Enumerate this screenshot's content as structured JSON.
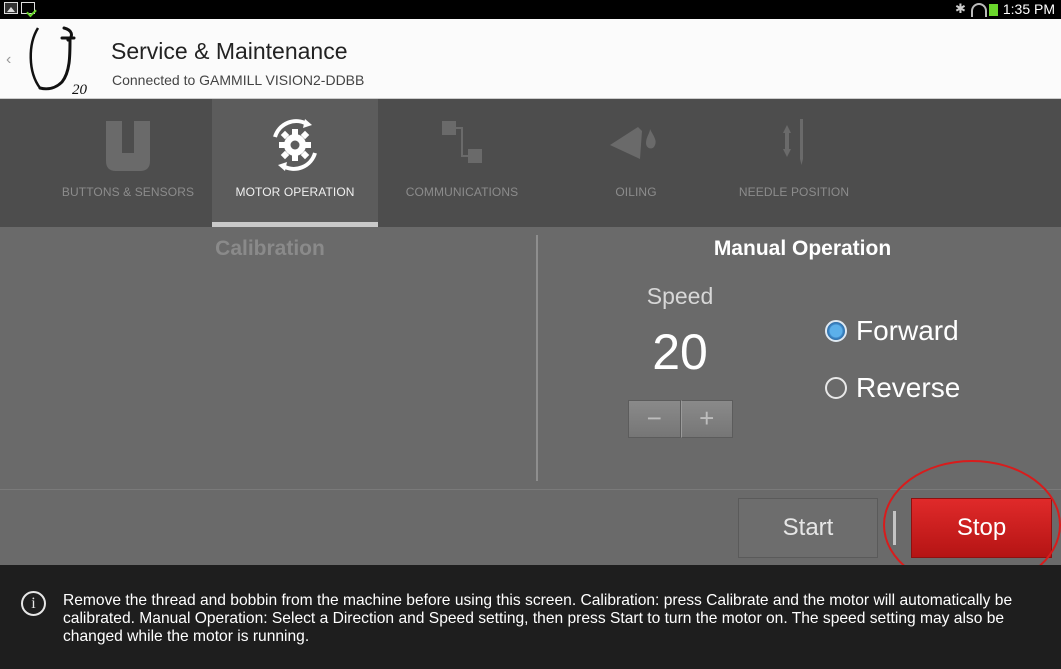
{
  "status_bar": {
    "time": "1:35 PM",
    "icons": [
      "gallery-icon",
      "download-icon",
      "bluetooth-icon",
      "wifi-icon",
      "battery-icon"
    ]
  },
  "header": {
    "title": "Service & Maintenance",
    "subtitle": "Connected to GAMMILL VISION2-DDBB",
    "logo_text": "20"
  },
  "tabs": [
    {
      "label": "BUTTONS & SENSORS",
      "icon": "buttons-sensors-icon",
      "active": false
    },
    {
      "label": "MOTOR OPERATION",
      "icon": "motor-gear-icon",
      "active": true
    },
    {
      "label": "COMMUNICATIONS",
      "icon": "communications-icon",
      "active": false
    },
    {
      "label": "OILING",
      "icon": "oiling-icon",
      "active": false
    },
    {
      "label": "NEEDLE POSITION",
      "icon": "needle-position-icon",
      "active": false
    }
  ],
  "calibration": {
    "title": "Calibration"
  },
  "manual": {
    "title": "Manual Operation",
    "speed_label": "Speed",
    "speed_value": "20",
    "minus": "−",
    "plus": "+",
    "direction_options": [
      {
        "label": "Forward",
        "checked": true
      },
      {
        "label": "Reverse",
        "checked": false
      }
    ]
  },
  "actions": {
    "start_label": "Start",
    "stop_label": "Stop"
  },
  "info": {
    "icon_glyph": "i",
    "text": "Remove the thread and bobbin from the machine before using this screen. Calibration: press Calibrate and the motor will automatically be calibrated. Manual Operation: Select a Direction and Speed setting, then press Start to turn the motor on. The speed setting may also be changed while the motor is running."
  },
  "colors": {
    "tab_bar": "#4d4d4d",
    "panel": "#6a6a6a",
    "stop_red": "#c81d1d",
    "highlight_ring": "#d81c1c",
    "radio_blue": "#3d86c6"
  }
}
